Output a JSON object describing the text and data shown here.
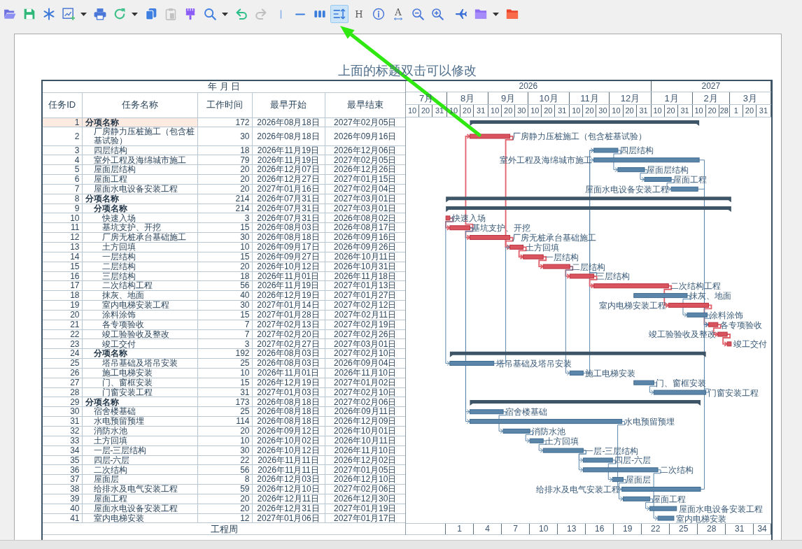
{
  "toolbar": [
    {
      "kind": "icon",
      "selected": false,
      "disabled": false
    },
    {
      "kind": "icon",
      "selected": false,
      "disabled": false
    },
    {
      "kind": "icon",
      "selected": false,
      "disabled": false
    },
    {
      "kind": "icon",
      "selected": false,
      "disabled": false,
      "dropdown": true
    },
    {
      "kind": "icon",
      "selected": false,
      "disabled": false
    },
    {
      "kind": "icon",
      "selected": false,
      "disabled": false,
      "dropdown": true
    },
    {
      "kind": "icon",
      "selected": false,
      "disabled": false
    },
    {
      "kind": "icon",
      "selected": false,
      "disabled": true
    },
    {
      "kind": "icon",
      "selected": false,
      "disabled": false
    },
    {
      "kind": "icon",
      "selected": false,
      "disabled": false,
      "dropdown": true
    },
    {
      "kind": "icon",
      "selected": false,
      "disabled": false
    },
    {
      "kind": "icon",
      "selected": false,
      "disabled": true
    },
    {
      "kind": "icon",
      "selected": false,
      "disabled": false
    },
    {
      "kind": "icon",
      "selected": false,
      "disabled": false
    },
    {
      "kind": "icon",
      "selected": false,
      "disabled": false
    },
    {
      "kind": "icon",
      "selected": true,
      "disabled": false
    },
    {
      "kind": "glyph",
      "glyph": "H",
      "selected": false,
      "disabled": false
    },
    {
      "kind": "icon",
      "selected": false,
      "disabled": false
    },
    {
      "kind": "glyph",
      "glyph": "A",
      "selected": false,
      "disabled": false
    },
    {
      "kind": "icon",
      "selected": false,
      "disabled": false
    },
    {
      "kind": "icon",
      "selected": false,
      "disabled": false
    },
    {
      "kind": "icon",
      "selected": false,
      "disabled": false
    },
    {
      "kind": "icon",
      "selected": false,
      "disabled": false,
      "dropdown": true
    },
    {
      "kind": "icon",
      "selected": false,
      "disabled": false
    }
  ],
  "title": "上面的标题双击可以修改",
  "table": {
    "date_caption": "年 月 日",
    "columns": [
      "任务ID",
      "任务名称",
      "工作时间",
      "最早开始",
      "最早结束"
    ]
  },
  "timeline": {
    "years": [
      {
        "label": "2026",
        "months": [
          {
            "label": "7月",
            "days": [
              "10",
              "20",
              "31"
            ]
          },
          {
            "label": "8月",
            "days": [
              "10",
              "20",
              "31"
            ]
          },
          {
            "label": "9月",
            "days": [
              "10",
              "20",
              "30"
            ]
          },
          {
            "label": "10月",
            "days": [
              "10",
              "20",
              "31"
            ]
          },
          {
            "label": "11月",
            "days": [
              "10",
              "20",
              "30"
            ]
          },
          {
            "label": "12月",
            "days": [
              "10",
              "20",
              "31"
            ]
          }
        ]
      },
      {
        "label": "2027",
        "months": [
          {
            "label": "1月",
            "days": [
              "10",
              "20",
              "31"
            ]
          },
          {
            "label": "2月",
            "days": [
              "10",
              "20",
              "28"
            ]
          },
          {
            "label": "3月",
            "days": [
              "1",
              "20",
              "31"
            ]
          }
        ]
      }
    ]
  },
  "tasks": [
    {
      "id": "1",
      "name": "分项名称",
      "duration": "172",
      "start": "2026年08月18日",
      "end": "2027年02月05日",
      "selected": true,
      "children": [
        {
          "id": "2",
          "name": "厂房静力压桩施工（包含桩基试验）",
          "duration": "30",
          "start": "2026年08月18日",
          "end": "2026年09月16日",
          "selected": false,
          "critical": true,
          "bar_label": "厂房静力压桩施工（包含桩基试验）",
          "label_left": false
        },
        {
          "id": "3",
          "name": "四层结构",
          "duration": "18",
          "start": "2026年11月19日",
          "end": "2026年12月06日",
          "selected": false,
          "critical": false,
          "bar_label": "四层结构",
          "label_left": false
        },
        {
          "id": "4",
          "name": "室外工程及海绵城市施工",
          "duration": "79",
          "start": "2026年11月19日",
          "end": "2027年02月05日",
          "selected": false,
          "critical": false,
          "bar_label": "室外工程及海绵城市施工",
          "label_left": true
        },
        {
          "id": "5",
          "name": "屋面层结构",
          "duration": "20",
          "start": "2026年12月07日",
          "end": "2026年12月26日",
          "selected": false,
          "critical": false,
          "bar_label": "屋面层结构",
          "label_left": false
        },
        {
          "id": "6",
          "name": "屋面工程",
          "duration": "20",
          "start": "2026年12月27日",
          "end": "2027年01月15日",
          "selected": false,
          "critical": false,
          "bar_label": "屋面工程",
          "label_left": false
        },
        {
          "id": "7",
          "name": "屋面水电设备安装工程",
          "duration": "20",
          "start": "2027年01月16日",
          "end": "2027年02月04日",
          "selected": false,
          "critical": false,
          "bar_label": "屋面水电设备安装工程",
          "label_left": true
        }
      ]
    },
    {
      "id": "8",
      "name": "分项名称",
      "duration": "214",
      "start": "2026年07月31日",
      "end": "2027年03月01日",
      "selected": false,
      "children": [
        {
          "id": "9",
          "name": "分项名称",
          "duration": "214",
          "start": "2026年07月31日",
          "end": "2027年03月01日",
          "selected": false,
          "children": [
            {
              "id": "10",
              "name": "快速入场",
              "duration": "3",
              "start": "2026年07月31日",
              "end": "2026年08月02日",
              "selected": false,
              "critical": true,
              "bar_label": "快速入场",
              "label_left": false
            },
            {
              "id": "11",
              "name": "基坑支护、开挖",
              "duration": "15",
              "start": "2026年08月03日",
              "end": "2026年08月17日",
              "selected": false,
              "critical": true,
              "bar_label": "基坑支护、开挖",
              "label_left": false
            },
            {
              "id": "12",
              "name": "厂房无桩承台基础施工",
              "duration": "30",
              "start": "2026年08月18日",
              "end": "2026年09月16日",
              "selected": false,
              "critical": true,
              "bar_label": "厂房无桩承台基础施工",
              "label_left": false
            },
            {
              "id": "13",
              "name": "土方回填",
              "duration": "10",
              "start": "2026年09月17日",
              "end": "2026年09月26日",
              "selected": false,
              "critical": true,
              "bar_label": "土方回填",
              "label_left": false
            },
            {
              "id": "14",
              "name": "一层结构",
              "duration": "15",
              "start": "2026年09月27日",
              "end": "2026年10月11日",
              "selected": false,
              "critical": true,
              "bar_label": "一层结构",
              "label_left": false
            },
            {
              "id": "15",
              "name": "二层结构",
              "duration": "20",
              "start": "2026年10月12日",
              "end": "2026年10月31日",
              "selected": false,
              "critical": true,
              "bar_label": "二层结构",
              "label_left": false
            },
            {
              "id": "16",
              "name": "三层结构",
              "duration": "18",
              "start": "2026年11月01日",
              "end": "2026年11月18日",
              "selected": false,
              "critical": true,
              "bar_label": "三层结构",
              "label_left": false
            },
            {
              "id": "17",
              "name": "二次结构工程",
              "duration": "56",
              "start": "2026年11月19日",
              "end": "2027年01月13日",
              "selected": false,
              "critical": true,
              "bar_label": "二次结构工程",
              "label_left": false
            },
            {
              "id": "18",
              "name": "抹灰、地面",
              "duration": "40",
              "start": "2026年12月19日",
              "end": "2027年01月27日",
              "selected": false,
              "critical": false,
              "bar_label": "抹灰、地面",
              "label_left": false
            },
            {
              "id": "19",
              "name": "室内电梯安装工程",
              "duration": "30",
              "start": "2027年01月14日",
              "end": "2027年02月12日",
              "selected": false,
              "critical": true,
              "bar_label": "室内电梯安装工程",
              "label_left": true
            },
            {
              "id": "20",
              "name": "涂料涂饰",
              "duration": "15",
              "start": "2027年01月28日",
              "end": "2027年02月11日",
              "selected": false,
              "critical": false,
              "bar_label": "涂料涂饰",
              "label_left": false
            },
            {
              "id": "21",
              "name": "各专项验收",
              "duration": "7",
              "start": "2027年02月13日",
              "end": "2027年02月19日",
              "selected": false,
              "critical": true,
              "bar_label": "各专项验收",
              "label_left": false
            },
            {
              "id": "22",
              "name": "竣工验验收及整改",
              "duration": "7",
              "start": "2027年02月20日",
              "end": "2027年02月26日",
              "selected": false,
              "critical": true,
              "bar_label": "竣工验验收及整改",
              "label_left": true
            },
            {
              "id": "23",
              "name": "竣工交付",
              "duration": "3",
              "start": "2027年02月27日",
              "end": "2027年03月01日",
              "selected": false,
              "critical": true,
              "bar_label": "竣工交付",
              "label_left": false
            }
          ]
        },
        {
          "id": "24",
          "name": "分项名称",
          "duration": "192",
          "start": "2026年08月03日",
          "end": "2027年02月10日",
          "selected": false,
          "children": [
            {
              "id": "25",
              "name": "塔吊基础及塔吊安装",
              "duration": "25",
              "start": "2026年08月03日",
              "end": "2026年09月04日",
              "selected": false,
              "critical": false,
              "bar_label": "塔吊基础及塔吊安装",
              "label_left": false
            },
            {
              "id": "26",
              "name": "施工电梯安装",
              "duration": "10",
              "start": "2026年11月01日",
              "end": "2026年11月10日",
              "selected": false,
              "critical": false,
              "bar_label": "施工电梯安装",
              "label_left": false
            },
            {
              "id": "27",
              "name": "门、窗框安装",
              "duration": "15",
              "start": "2026年12月19日",
              "end": "2027年01月02日",
              "selected": false,
              "critical": false,
              "bar_label": "门、窗框安装",
              "label_left": false
            },
            {
              "id": "28",
              "name": "门窗安装工程",
              "duration": "31",
              "start": "2027年01月03日",
              "end": "2027年02月10日",
              "selected": false,
              "critical": false,
              "bar_label": "门窗安装工程",
              "label_left": false
            }
          ]
        }
      ]
    },
    {
      "id": "29",
      "name": "分项名称",
      "duration": "173",
      "start": "2026年08月18日",
      "end": "2027年02月06日",
      "selected": false,
      "children": [
        {
          "id": "30",
          "name": "宿舍楼基础",
          "duration": "25",
          "start": "2026年08月18日",
          "end": "2026年09月11日",
          "selected": false,
          "critical": false,
          "bar_label": "宿舍楼基础",
          "label_left": false
        },
        {
          "id": "31",
          "name": "水电预留预埋",
          "duration": "114",
          "start": "2026年08月18日",
          "end": "2026年12月09日",
          "selected": false,
          "critical": false,
          "bar_label": "水电预留预埋",
          "label_left": false
        },
        {
          "id": "32",
          "name": "消防水池",
          "duration": "20",
          "start": "2026年09月12日",
          "end": "2026年10月01日",
          "selected": false,
          "critical": false,
          "bar_label": "消防水池",
          "label_left": false
        },
        {
          "id": "33",
          "name": "土方回填",
          "duration": "10",
          "start": "2026年10月02日",
          "end": "2026年10月11日",
          "selected": false,
          "critical": false,
          "bar_label": "土方回填",
          "label_left": false
        },
        {
          "id": "34",
          "name": "一层-三层结构",
          "duration": "30",
          "start": "2026年10月12日",
          "end": "2026年11月10日",
          "selected": false,
          "critical": false,
          "bar_label": "一层-三层结构",
          "label_left": false
        },
        {
          "id": "35",
          "name": "四层-六层",
          "duration": "22",
          "start": "2026年11月11日",
          "end": "2026年12月02日",
          "selected": false,
          "critical": false,
          "bar_label": "四层-六层",
          "label_left": false
        },
        {
          "id": "36",
          "name": "二次结构",
          "duration": "56",
          "start": "2026年11月11日",
          "end": "2027年01月05日",
          "selected": false,
          "critical": false,
          "bar_label": "二次结构",
          "label_left": false
        },
        {
          "id": "37",
          "name": "屋面层",
          "duration": "8",
          "start": "2026年12月03日",
          "end": "2026年12月10日",
          "selected": false,
          "critical": false,
          "bar_label": "屋面层",
          "label_left": false
        },
        {
          "id": "38",
          "name": "给排水及电气安装工程",
          "duration": "59",
          "start": "2026年12月10日",
          "end": "2027年02月06日",
          "selected": false,
          "critical": false,
          "bar_label": "给排水及电气安装工程",
          "label_left": true
        },
        {
          "id": "39",
          "name": "屋面工程",
          "duration": "20",
          "start": "2026年12月11日",
          "end": "2026年12月30日",
          "selected": false,
          "critical": false,
          "bar_label": "屋面工程",
          "label_left": false
        },
        {
          "id": "40",
          "name": "屋面水电设备安装工程",
          "duration": "20",
          "start": "2026年12月31日",
          "end": "2027年01月19日",
          "selected": false,
          "critical": false,
          "bar_label": "屋面水电设备安装工程",
          "label_left": false
        },
        {
          "id": "41",
          "name": "室内电梯安装",
          "duration": "12",
          "start": "2027年01月06日",
          "end": "2027年01月17日",
          "selected": false,
          "critical": false,
          "bar_label": "室内电梯安装",
          "label_left": false
        }
      ]
    }
  ],
  "week_row": {
    "label": "工程周",
    "weeks": [
      "1",
      "4",
      "7",
      "10",
      "13",
      "16",
      "19",
      "22",
      "25",
      "28",
      "31",
      "34"
    ]
  }
}
